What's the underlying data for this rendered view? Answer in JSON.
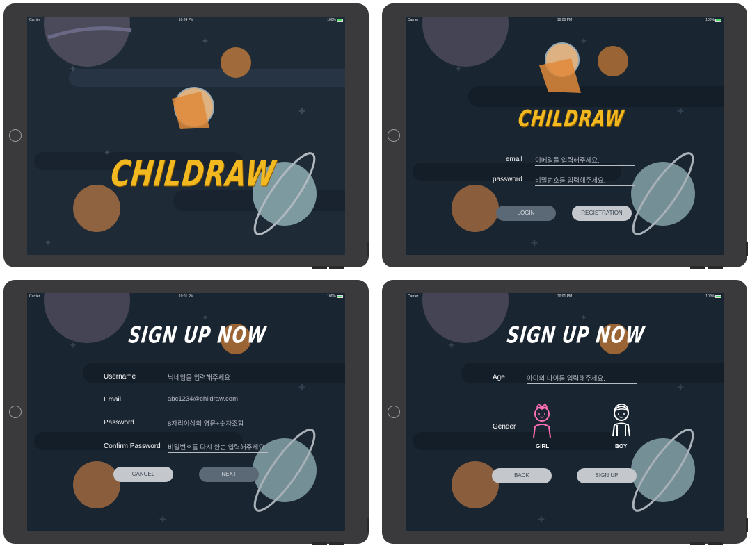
{
  "colors": {
    "logo": "#f2b81f",
    "girl_icon": "#ff6fb5",
    "boy_icon": "#ffffff",
    "screen_bg": "#1f2a37"
  },
  "splash": {
    "status": {
      "carrier": "Carrier",
      "time": "10:24 PM",
      "battery": "100%"
    },
    "logo": "CHILDRAW"
  },
  "login": {
    "status": {
      "carrier": "Carrier",
      "time": "10:00 PM",
      "battery": "100%"
    },
    "logo": "CHILDRAW",
    "email_label": "email",
    "email_placeholder": "이메일을 입력해주세요.",
    "password_label": "password",
    "password_placeholder": "비밀번호를 입력해주세요.",
    "login_button": "LOGIN",
    "registration_button": "REGISTRATION"
  },
  "signup1": {
    "status": {
      "carrier": "Carrier",
      "time": "10:01 PM",
      "battery": "100%"
    },
    "title": "SIGN UP NOW",
    "username_label": "Username",
    "username_placeholder": "닉네임을 입력해주세요",
    "email_label": "Email",
    "email_placeholder": "abc1234@childraw.com",
    "password_label": "Password",
    "password_placeholder": "8자리이상의 영문+숫자조합",
    "confirm_label": "Confirm Password",
    "confirm_placeholder": "비밀번호를 다시 한번 입력해주세요",
    "cancel_button": "CANCEL",
    "next_button": "NEXT"
  },
  "signup2": {
    "status": {
      "carrier": "Carrier",
      "time": "10:01 PM",
      "battery": "100%"
    },
    "title": "SIGN UP NOW",
    "age_label": "Age",
    "age_placeholder": "아이의 나이를 입력해주세요.",
    "gender_label": "Gender",
    "girl_label": "GIRL",
    "boy_label": "BOY",
    "girl_icon": "girl-icon",
    "boy_icon": "boy-icon",
    "back_button": "BACK",
    "signup_button": "SIGN UP"
  }
}
